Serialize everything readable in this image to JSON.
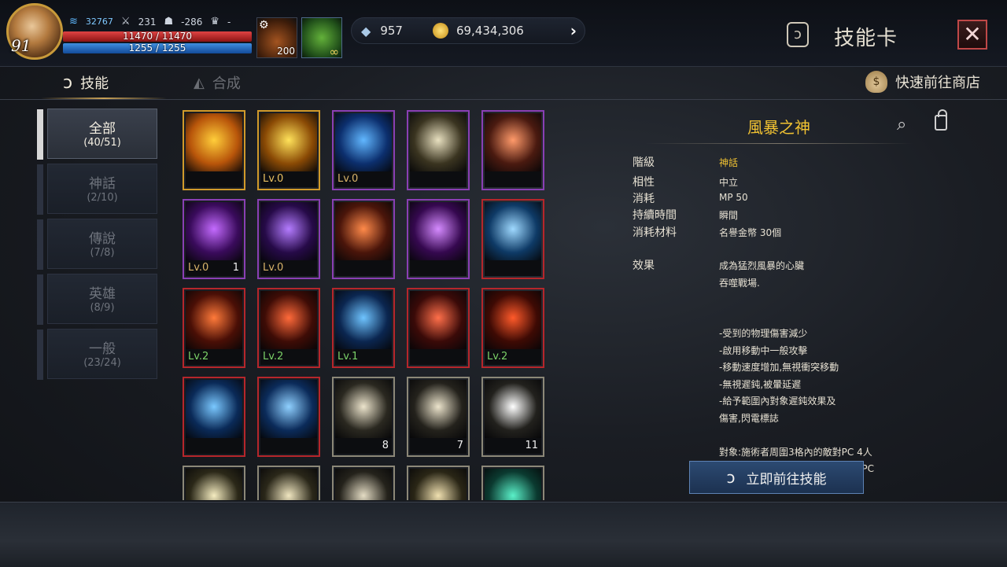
{
  "player": {
    "level": "91",
    "power": "32767",
    "attack": "231",
    "defense": "-286",
    "trophy": "-",
    "hp_text": "11470 / 11470",
    "mp_text": "1255 / 1255"
  },
  "items": {
    "potion_count": "200",
    "leaf_count": "∞"
  },
  "currency": {
    "gems": "957",
    "gold": "69,434,306"
  },
  "header": {
    "title": "技能卡",
    "close_label": "✕"
  },
  "tabs": {
    "skill": "技能",
    "compose": "合成",
    "shop": "快速前往商店"
  },
  "categories": [
    {
      "name": "全部",
      "count": "(40/51)"
    },
    {
      "name": "神話",
      "count": "(2/10)"
    },
    {
      "name": "傳說",
      "count": "(7/8)"
    },
    {
      "name": "英雄",
      "count": "(8/9)"
    },
    {
      "name": "一般",
      "count": "(23/24)"
    }
  ],
  "cards": [
    {
      "rarity": "mythic",
      "lv": "",
      "count": "",
      "colors": [
        "#ffce3a",
        "#b8550a"
      ]
    },
    {
      "rarity": "mythic",
      "lv": "Lv.0",
      "count": "",
      "colors": [
        "#ffe25a",
        "#8a4a05"
      ]
    },
    {
      "rarity": "legend",
      "lv": "Lv.0",
      "count": "",
      "colors": [
        "#61b7ff",
        "#0c2f6e"
      ]
    },
    {
      "rarity": "legend",
      "lv": "",
      "count": "",
      "colors": [
        "#e8e0c0",
        "#3a3420"
      ]
    },
    {
      "rarity": "legend",
      "lv": "",
      "count": "",
      "colors": [
        "#ff9a6a",
        "#4a1a10"
      ]
    },
    {
      "rarity": "legend",
      "lv": "Lv.0",
      "count": "1",
      "colors": [
        "#c46bff",
        "#3a0b5c"
      ]
    },
    {
      "rarity": "legend",
      "lv": "Lv.0",
      "count": "",
      "colors": [
        "#b47cff",
        "#260a48"
      ]
    },
    {
      "rarity": "legend",
      "lv": "",
      "count": "",
      "colors": [
        "#ff8a4a",
        "#4a150a"
      ]
    },
    {
      "rarity": "legend",
      "lv": "",
      "count": "",
      "colors": [
        "#d58bff",
        "#35084f"
      ]
    },
    {
      "rarity": "hero",
      "lv": "",
      "count": "",
      "colors": [
        "#9fd9ff",
        "#0e3a66"
      ]
    },
    {
      "rarity": "hero",
      "lv": "Lv.2",
      "count": "",
      "colors": [
        "#ff7a3a",
        "#4a0f06"
      ]
    },
    {
      "rarity": "hero",
      "lv": "Lv.2",
      "count": "",
      "colors": [
        "#ff6a3a",
        "#3e0c06"
      ]
    },
    {
      "rarity": "hero",
      "lv": "Lv.1",
      "count": "",
      "colors": [
        "#6fc4ff",
        "#0b2650"
      ]
    },
    {
      "rarity": "hero",
      "lv": "",
      "count": "",
      "colors": [
        "#ff6f4a",
        "#3a0a08"
      ]
    },
    {
      "rarity": "hero",
      "lv": "Lv.2",
      "count": "",
      "colors": [
        "#ff5a2a",
        "#3e0a04"
      ]
    },
    {
      "rarity": "hero",
      "lv": "",
      "count": "",
      "colors": [
        "#7ac8ff",
        "#0a2a58"
      ]
    },
    {
      "rarity": "hero",
      "lv": "",
      "count": "",
      "colors": [
        "#8fd0ff",
        "#0b2b5a"
      ]
    },
    {
      "rarity": "normal",
      "lv": "",
      "count": "8",
      "colors": [
        "#ece4cc",
        "#2a2820"
      ]
    },
    {
      "rarity": "normal",
      "lv": "",
      "count": "7",
      "colors": [
        "#ece4cc",
        "#24221c"
      ]
    },
    {
      "rarity": "normal",
      "lv": "",
      "count": "11",
      "colors": [
        "#ffffff",
        "#22211d"
      ]
    },
    {
      "rarity": "normal",
      "lv": "",
      "count": "",
      "colors": [
        "#f5ecc0",
        "#2b2818"
      ]
    },
    {
      "rarity": "normal",
      "lv": "",
      "count": "",
      "colors": [
        "#f0e6c0",
        "#2a2719"
      ]
    },
    {
      "rarity": "normal",
      "lv": "",
      "count": "",
      "colors": [
        "#e4dcc4",
        "#24221b"
      ]
    },
    {
      "rarity": "normal",
      "lv": "",
      "count": "",
      "colors": [
        "#f0e0b0",
        "#2a2616"
      ]
    },
    {
      "rarity": "normal",
      "lv": "",
      "count": "",
      "colors": [
        "#5af0c8",
        "#0b3a30"
      ]
    }
  ],
  "detail": {
    "title": "風暴之神",
    "rows": [
      {
        "label": "階級",
        "value": "神話"
      },
      {
        "label": "相性",
        "value": "中立"
      },
      {
        "label": "消耗",
        "value": "MP 50"
      },
      {
        "label": "持續時間",
        "value": "瞬間"
      },
      {
        "label": "消耗材料",
        "value": "名譽金幣 30個"
      }
    ],
    "effect_label": "效果",
    "effect_text": "成為猛烈風暴的心臟\n吞噬戰場.\n\n\n-受到的物理傷害減少\n-啟用移動中一般攻擊\n-移動速度增加,無視衝突移動\n-無視遲鈍,被暈延遲\n-給予範圍內對象遲鈍效果及\n傷害,閃電標誌\n\n對象:施術者周圍3格內的敵對PC 4人\n* 敵對PC為被設定為敵對或敵軍的PC",
    "go_button": "立即前往技能"
  }
}
